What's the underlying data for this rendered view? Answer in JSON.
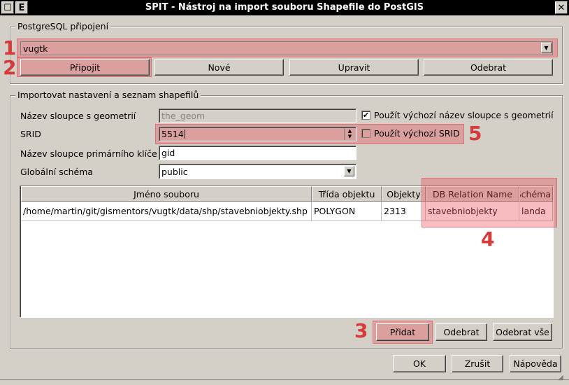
{
  "window": {
    "title": "SPIT - Nástroj na import souboru Shapefile do PostGIS",
    "left_buttons": [
      "☐",
      "E"
    ],
    "close": "✕"
  },
  "connection": {
    "group_title": "PostgreSQL připojení",
    "selected": "vugtk",
    "buttons": {
      "connect": "Připojit",
      "new": "Nové",
      "edit": "Upravit",
      "remove": "Odebrat"
    }
  },
  "import": {
    "group_title": "Importovat nastavení a seznam shapefilů",
    "geom_label": "Název sloupce s geometrií",
    "geom_value": "the_geom",
    "geom_default_label": "Použít výchozí název sloupce s geometrií",
    "geom_default_checked": true,
    "srid_label": "SRID",
    "srid_value": "5514",
    "srid_default_label": "Použít výchozí SRID",
    "srid_default_checked": false,
    "pk_label": "Název sloupce primárního klíče",
    "pk_value": "gid",
    "schema_label": "Globální schéma",
    "schema_value": "public"
  },
  "table": {
    "columns": [
      "Jméno souboru",
      "Třída objektu",
      "Objekty",
      "DB Relation Name",
      "Schéma"
    ],
    "rows": [
      [
        "/home/martin/git/gismentors/vugtk/data/shp/stavebniobjekty.shp",
        "POLYGON",
        "2313",
        "stavebniobjekty",
        "landa"
      ]
    ]
  },
  "table_buttons": {
    "add": "Přidat",
    "remove": "Odebrat",
    "remove_all": "Odebrat vše"
  },
  "dialog_buttons": {
    "ok": "OK",
    "cancel": "Zrušit",
    "help": "Nápověda"
  },
  "markers": [
    "1",
    "2",
    "3",
    "4",
    "5"
  ],
  "colors": {
    "highlight": "#e8505a",
    "marker": "#d63a3a"
  }
}
